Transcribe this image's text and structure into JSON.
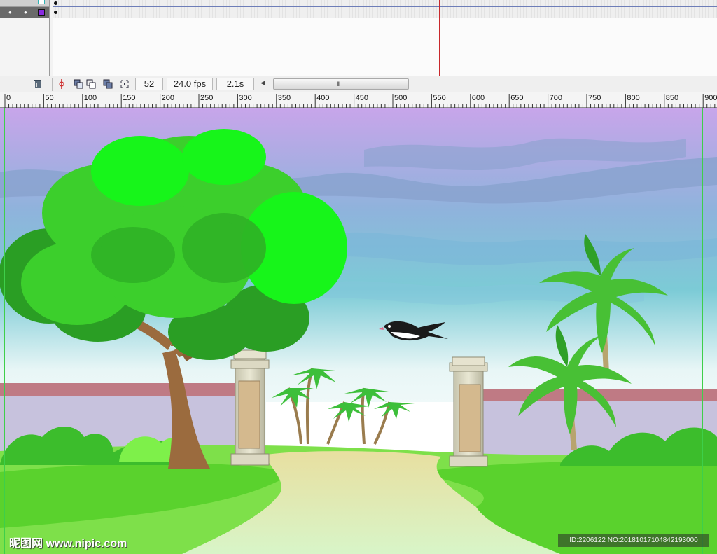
{
  "timeline": {
    "layers": [
      {
        "name_icon": "layer-eye-dot-icon",
        "outline_color": "#2fb3b3"
      },
      {
        "name_icon": "layer-eye-dot-icon",
        "outline_color": "#8a2be2"
      }
    ],
    "delete_icon": "trash-icon",
    "frame_number": "52",
    "frame_rate": "24.0 fps",
    "elapsed_time": "2.1s",
    "scroll_left_glyph": "◀",
    "scroll_grip_glyph": "III"
  },
  "ruler": {
    "labels": [
      "0",
      "50",
      "100",
      "150",
      "200",
      "250",
      "300",
      "350",
      "400",
      "450",
      "500",
      "550",
      "600",
      "650",
      "700",
      "750",
      "800",
      "850",
      "900"
    ]
  },
  "stage": {
    "scene": "cartoon park gate with tree, palms and flying swallow",
    "colors": {
      "sky_top": "#c7a6e8",
      "sky_bottom": "#ffffff",
      "grass": "#5dd62a",
      "guide": "#3ecf4a"
    }
  },
  "watermark": {
    "site": "昵图网 www.nipic.com",
    "id_text": "ID:2206122 NO:20181017104842193000"
  }
}
